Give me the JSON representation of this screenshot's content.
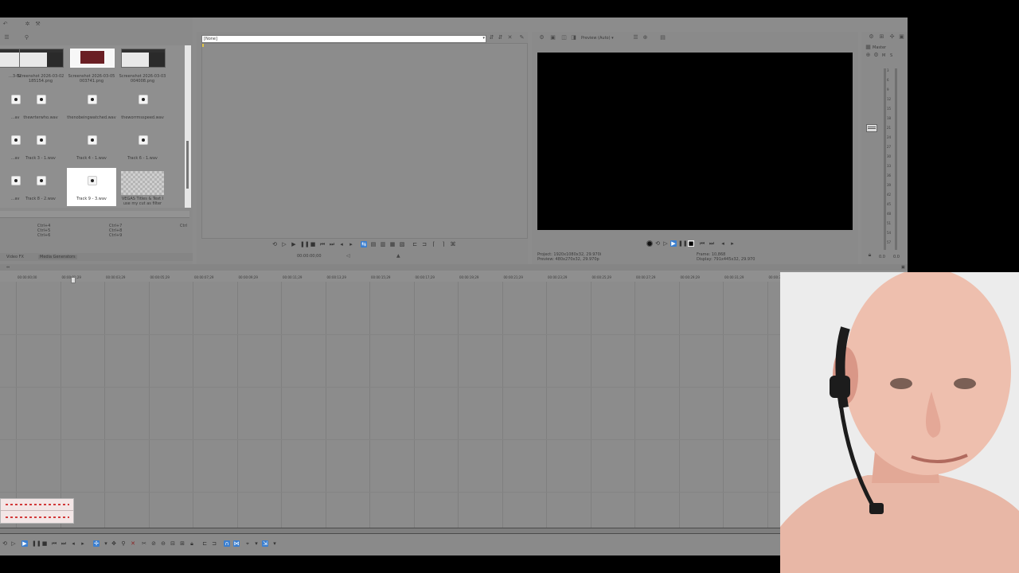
{
  "explorer": {
    "media": [
      {
        "label": "…3-02",
        "kind": "image",
        "sub": "…png"
      },
      {
        "label": "Screenshot 2026-03-02 185154.png",
        "kind": "image"
      },
      {
        "label": "Screenshot 2026-03-05 003741.png",
        "kind": "image-selected"
      },
      {
        "label": "Screenshot 2026-03-03 004008.png",
        "kind": "image"
      },
      {
        "label": "…av",
        "kind": "audio"
      },
      {
        "label": "thewrterwho.wav",
        "kind": "audio"
      },
      {
        "label": "thenobeingwatched.wav",
        "kind": "audio"
      },
      {
        "label": "theworrmsspeed.wav",
        "kind": "audio"
      },
      {
        "label": "…av",
        "kind": "audio"
      },
      {
        "label": "Track 3 - 1.wav",
        "kind": "audio"
      },
      {
        "label": "Track 4 - 1.wav",
        "kind": "audio"
      },
      {
        "label": "Track 6 - 1.wav",
        "kind": "audio"
      },
      {
        "label": "…av",
        "kind": "audio"
      },
      {
        "label": "Track 8 - 2.wav",
        "kind": "audio"
      },
      {
        "label": "Track 9 - 3.wav",
        "kind": "audio-selected"
      },
      {
        "label": "VEGAS Titles & Text I use my cut as filter",
        "kind": "title"
      }
    ],
    "shortcuts_col1": [
      "Ctrl+4",
      "Ctrl+5",
      "Ctrl+6"
    ],
    "shortcuts_col2": [
      "Ctrl+7",
      "Ctrl+8",
      "Ctrl+9"
    ],
    "shortcut_col3": "Ctrl",
    "tabs": [
      "Video FX",
      "Media Generators"
    ]
  },
  "trimmer": {
    "dropdown_value": "[None]",
    "timecode": "00:00:00;00"
  },
  "preview": {
    "quality": "Preview (Auto)",
    "project_label": "Project:",
    "project_value": "1920x1080x32, 29.970i",
    "preview_label": "Preview:",
    "preview_value": "480x270x32, 29.970p",
    "frame_label": "Frame:",
    "frame_value": "10,868",
    "display_label": "Display:",
    "display_value": "791x445x32, 29.970"
  },
  "mixer": {
    "title": "Master",
    "scale": [
      "3",
      "6",
      "9",
      "12",
      "15",
      "18",
      "21",
      "24",
      "27",
      "30",
      "33",
      "36",
      "39",
      "42",
      "45",
      "48",
      "51",
      "54",
      "57"
    ],
    "bottom_left": "0.0",
    "bottom_right": "0.0"
  },
  "timeline": {
    "ruler": [
      "00:00:00;00",
      "00:00:01;29",
      "00:00:03;29",
      "00:00:05;29",
      "00:00:07;29",
      "00:00:09;29",
      "00:00:11;29",
      "00:00:13;29",
      "00:00:15;29",
      "00:00:17;29",
      "00:00:19;29",
      "00:00:21;29",
      "00:00:23;29",
      "00:00:25;29",
      "00:00:27;29",
      "00:00:29;29",
      "00:00:31;29",
      "00:00:33;29",
      "00:00:35;29"
    ]
  },
  "colors": {
    "app_bg": "#8c8c8c",
    "preview_screen": "#000000",
    "accent": "#3b7fd0",
    "clip_red": "#d23a3a"
  }
}
